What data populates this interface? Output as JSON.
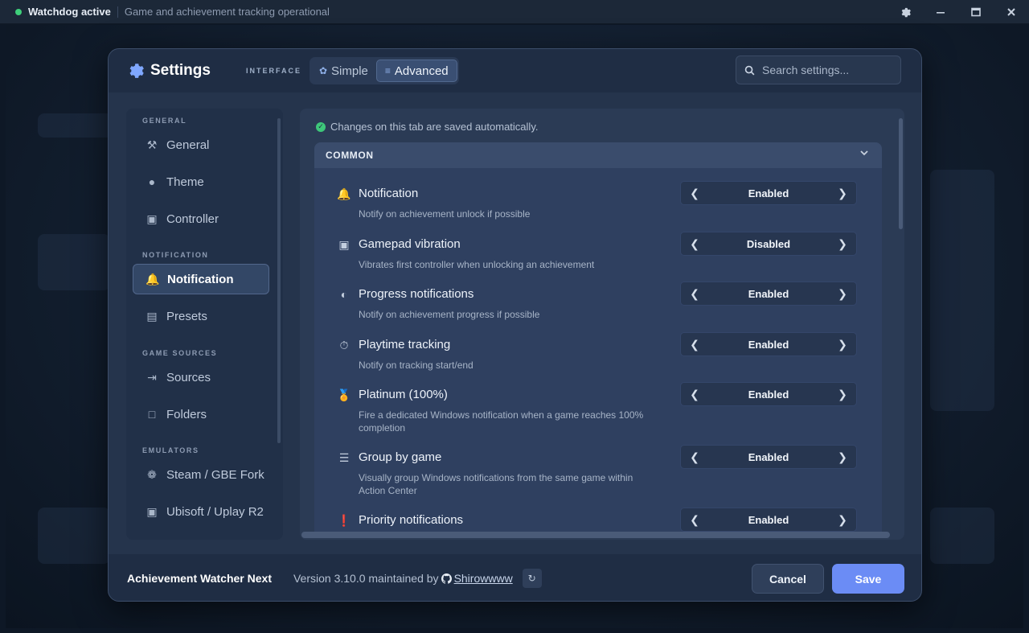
{
  "titlebar": {
    "status": "Watchdog active",
    "subtitle": "Game and achievement tracking operational",
    "status_color": "#3ecf7a"
  },
  "header": {
    "title": "Settings",
    "interface_label": "INTERFACE",
    "modes": [
      {
        "label": "Simple",
        "icon": "leaf-icon",
        "active": false
      },
      {
        "label": "Advanced",
        "icon": "sliders-icon",
        "active": true
      }
    ],
    "search_placeholder": "Search settings..."
  },
  "sidebar": {
    "sections": [
      {
        "title": "GENERAL",
        "items": [
          {
            "label": "General",
            "icon": "tools-icon"
          },
          {
            "label": "Theme",
            "icon": "palette-icon"
          },
          {
            "label": "Controller",
            "icon": "gamepad-icon"
          }
        ]
      },
      {
        "title": "NOTIFICATION",
        "items": [
          {
            "label": "Notification",
            "icon": "bell-icon",
            "active": true
          },
          {
            "label": "Presets",
            "icon": "toolbox-icon"
          }
        ]
      },
      {
        "title": "GAME SOURCES",
        "items": [
          {
            "label": "Sources",
            "icon": "file-import-icon"
          },
          {
            "label": "Folders",
            "icon": "folder-icon"
          }
        ]
      },
      {
        "title": "EMULATORS",
        "items": [
          {
            "label": "Steam / GBE Fork",
            "icon": "steam-icon"
          },
          {
            "label": "Ubisoft / Uplay R2",
            "icon": "gamepad-icon"
          }
        ]
      }
    ]
  },
  "content": {
    "autosave_note": "Changes on this tab are saved automatically.",
    "section_title": "COMMON",
    "rows": [
      {
        "label": "Notification",
        "desc": "Notify on achievement unlock if possible",
        "value": "Enabled",
        "icon": "bell-icon"
      },
      {
        "label": "Gamepad vibration",
        "desc": "Vibrates first controller when unlocking an achievement",
        "value": "Disabled",
        "icon": "gamepad-icon"
      },
      {
        "label": "Progress notifications",
        "desc": "Notify on achievement progress if possible",
        "value": "Enabled",
        "icon": "gauge-icon"
      },
      {
        "label": "Playtime tracking",
        "desc": "Notify on tracking start/end",
        "value": "Enabled",
        "icon": "stopwatch-icon"
      },
      {
        "label": "Platinum (100%)",
        "desc": "Fire a dedicated Windows notification when a game reaches 100% completion",
        "value": "Enabled",
        "icon": "medal-icon"
      },
      {
        "label": "Group by game",
        "desc": "Visually group Windows notifications from the same game within Action Center",
        "value": "Enabled",
        "icon": "layers-icon"
      },
      {
        "label": "Priority notifications",
        "desc": "",
        "value": "Enabled",
        "icon": "exclamation-icon"
      }
    ]
  },
  "footer": {
    "app_name": "Achievement Watcher Next",
    "version_text": "Version 3.10.0 maintained by",
    "author": "Shirowwww",
    "cancel_label": "Cancel",
    "save_label": "Save",
    "accent": "#6b8cf5"
  }
}
